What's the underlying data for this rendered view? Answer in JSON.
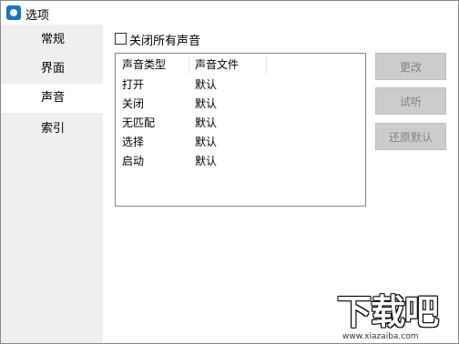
{
  "window": {
    "title": "选项",
    "icon": "app-icon"
  },
  "sidebar": {
    "items": [
      {
        "label": "常规",
        "active": false
      },
      {
        "label": "界面",
        "active": false
      },
      {
        "label": "声音",
        "active": true
      },
      {
        "label": "索引",
        "active": false
      }
    ]
  },
  "sound": {
    "mute_all_label": "关闭所有声音",
    "mute_all_checked": false,
    "columns": [
      "声音类型",
      "声音文件"
    ],
    "rows": [
      {
        "type": "打开",
        "file": "默认"
      },
      {
        "type": "关闭",
        "file": "默认"
      },
      {
        "type": "无匹配",
        "file": "默认"
      },
      {
        "type": "选择",
        "file": "默认"
      },
      {
        "type": "启动",
        "file": "默认"
      }
    ]
  },
  "buttons": {
    "change": "更改",
    "preview": "试听",
    "restore_default": "还原默认"
  },
  "watermark": {
    "logo_text": "下载吧",
    "url": "www.xiazaiba.com"
  }
}
